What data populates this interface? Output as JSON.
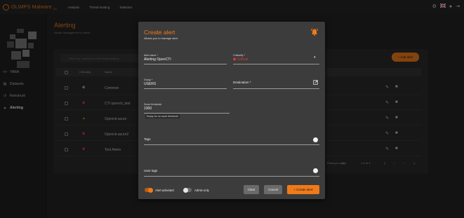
{
  "app": {
    "brand": "OLIMPS Malware",
    "version": "2.8",
    "nav": [
      "Analysis",
      "Threat hunting",
      "Statistics"
    ],
    "top_icons": [
      "gear-icon",
      "flag-uk-icon",
      "help-icon",
      "logout-icon"
    ]
  },
  "sidebar": {
    "items": [
      {
        "label": "YARA",
        "icon": "code-icon"
      },
      {
        "label": "Datasets",
        "icon": "dataset-icon"
      },
      {
        "label": "Retrohunt",
        "icon": "history-icon"
      },
      {
        "label": "Alerting",
        "icon": "bell-icon"
      }
    ]
  },
  "background": {
    "title": "Alerting",
    "subtitle": "Allows management of alerts",
    "search_placeholder": "Filter e.g. enable:true OR name:Alerting*",
    "add_button": "+ Add alert",
    "columns": [
      "Criticality",
      "Name"
    ],
    "rows": [
      {
        "name": "Common",
        "crit_icon": "shield-icon",
        "crit_color": "#9a9a9a"
      },
      {
        "name": "CTI opencti_test",
        "crit_icon": "shield-icon",
        "crit_color": "#d03030"
      },
      {
        "name": "Opencti-azure",
        "crit_icon": "bell-icon",
        "crit_color": "#d6a000"
      },
      {
        "name": "Opencti-azure2",
        "crit_icon": "shield-icon",
        "crit_color": "#d03030"
      },
      {
        "name": "Test Alerts",
        "crit_icon": "shield-icon",
        "crit_color": "#d03030"
      }
    ],
    "pager_label": "Rows per page:",
    "pager_value": "10",
    "pager_range": "1-4 of 4"
  },
  "modal": {
    "title": "Create alert",
    "subtitle": "Allows you to manage alert",
    "alert_name": {
      "label": "Alert name *",
      "value": "Alerting OpenCTI"
    },
    "criticality": {
      "label": "Criticality *",
      "value": "Critical",
      "color": "#e03a3a"
    },
    "group": {
      "label": "Group *",
      "value": "USERS"
    },
    "destination": {
      "label": "Destination *"
    },
    "score_threshold": {
      "label": "Score threshold",
      "value": "1000",
      "helper": "Empty for no score threshold"
    },
    "tags": {
      "label": "Tags"
    },
    "user_tags": {
      "label": "User tags"
    },
    "alert_activated": {
      "label": "Alert activated",
      "on": true
    },
    "admin_only": {
      "label": "Admin only",
      "on": false
    },
    "buttons": {
      "clear": "Clear",
      "cancel": "Cancel",
      "create": "+ Create alert"
    },
    "accent": "#ee7a1a"
  }
}
